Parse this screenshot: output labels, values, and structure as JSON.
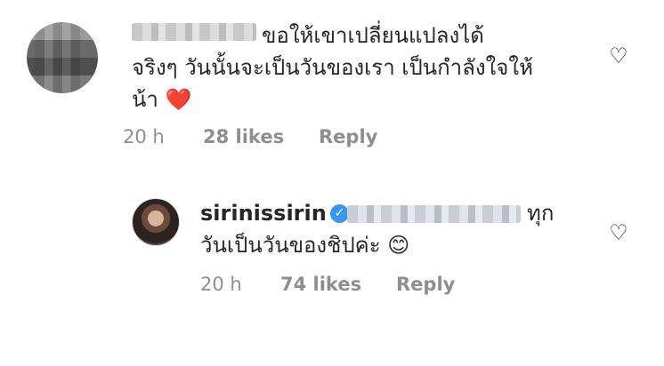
{
  "comments": [
    {
      "username": "",
      "lines": [
        "ขอให้เขาเปลี่ยนแปลงได้",
        "จริงๆ วันนั้นจะเป็นวันของเรา เป็นกำลังใจให้",
        "น้า"
      ],
      "emoji": "❤️",
      "time": "20 h",
      "likes": "28 likes",
      "reply": "Reply"
    },
    {
      "username": "sirinissirin",
      "verified": true,
      "lines": [
        "ทุก",
        "วันเป็นวันของชิปค่ะ"
      ],
      "emoji": "😊",
      "time": "20 h",
      "likes": "74 likes",
      "reply": "Reply"
    }
  ],
  "icons": {
    "like": "heart-outline-icon",
    "verified": "verified-badge-icon"
  },
  "colors": {
    "text": "#262626",
    "meta": "#8e8e8e",
    "verified": "#3897f0",
    "heart": "#e0245e"
  }
}
